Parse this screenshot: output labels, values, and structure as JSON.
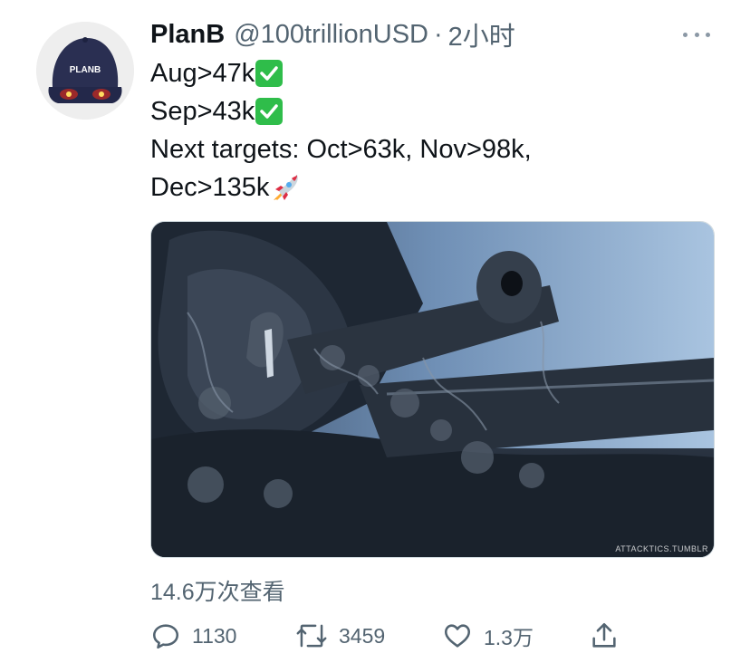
{
  "author": {
    "name": "PlanB",
    "handle": "@100trillionUSD",
    "separator": "·",
    "time": "2小时",
    "avatar_icon": "cap-avatar-icon",
    "cap_text": "PLANB"
  },
  "tweet": {
    "lines": [
      "Aug>47k",
      "Sep>43k",
      "Next targets: Oct>63k, Nov>98k,",
      "Dec>135k"
    ],
    "emojis": [
      "check-mark-icon",
      "check-mark-icon",
      "rocket-icon"
    ]
  },
  "media": {
    "type": "video",
    "watermark": "ATTACKTICS.TUMBLR"
  },
  "views": "14.6万次查看",
  "actions": {
    "reply_count": "1130",
    "retweet_count": "3459",
    "like_count": "1.3万"
  },
  "colors": {
    "text_primary": "#0f1419",
    "text_secondary": "#536471",
    "check_green": "#2fbd4a"
  }
}
